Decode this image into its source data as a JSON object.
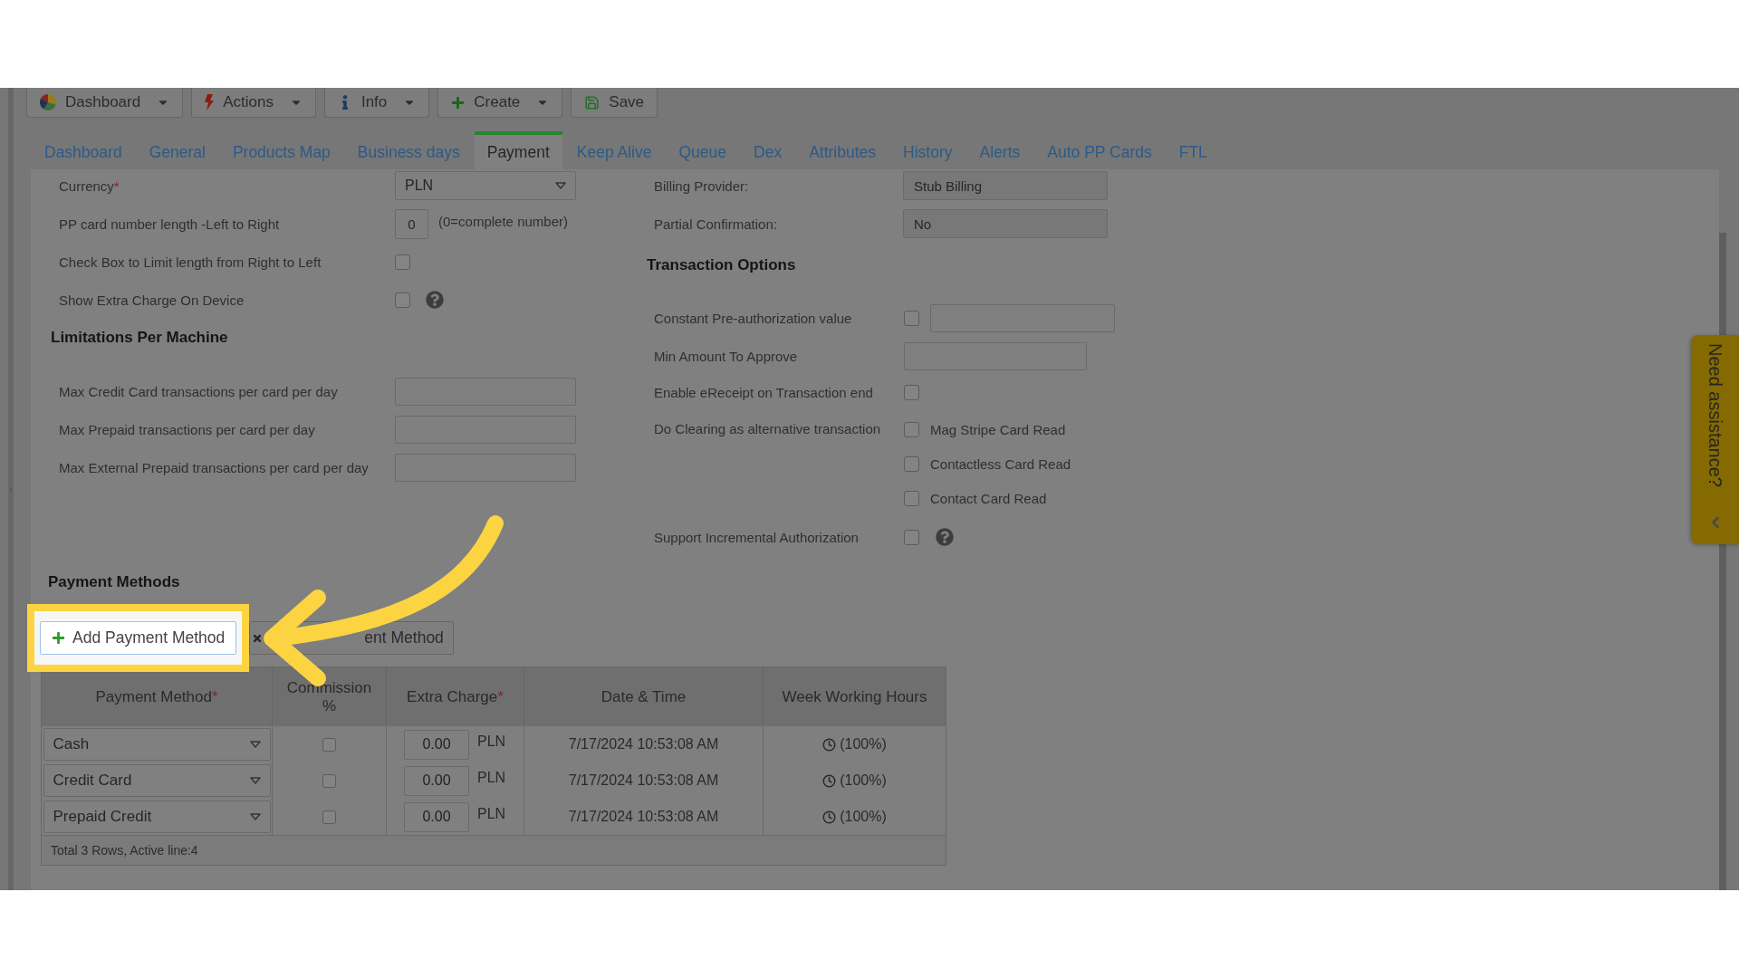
{
  "toolbar": [
    {
      "label": "Dashboard",
      "kind": "menu"
    },
    {
      "label": "Actions",
      "kind": "menu"
    },
    {
      "label": "Info",
      "kind": "menu"
    },
    {
      "label": "Create",
      "kind": "menu"
    },
    {
      "label": "Save",
      "kind": "button"
    }
  ],
  "tabs": [
    {
      "label": "Dashboard",
      "selected": false
    },
    {
      "label": "General",
      "selected": false
    },
    {
      "label": "Products Map",
      "selected": false
    },
    {
      "label": "Business days",
      "selected": false
    },
    {
      "label": "Payment",
      "selected": true
    },
    {
      "label": "Keep Alive",
      "selected": false
    },
    {
      "label": "Queue",
      "selected": false
    },
    {
      "label": "Dex",
      "selected": false
    },
    {
      "label": "Attributes",
      "selected": false
    },
    {
      "label": "History",
      "selected": false
    },
    {
      "label": "Alerts",
      "selected": false
    },
    {
      "label": "Auto PP Cards",
      "selected": false
    },
    {
      "label": "FTL",
      "selected": false
    }
  ],
  "general_settings": [
    {
      "kind": "select",
      "label": "Currency",
      "required_mark": "*",
      "value": "PLN"
    },
    {
      "kind": "number",
      "label": "PP card number length -Left to Right",
      "value": "0",
      "hint": "(0=complete number)"
    },
    {
      "kind": "checkbox",
      "label": "Check Box to Limit length from Right to Left",
      "checked": false
    },
    {
      "kind": "checkbox",
      "label": "Show Extra Charge On Device",
      "checked": false,
      "help": true
    }
  ],
  "limitations_per_machine": {
    "title": "Limitations Per Machine",
    "fields": [
      {
        "label": "Max Credit Card transactions per card per day"
      },
      {
        "label": "Max Prepaid transactions per card per day"
      },
      {
        "label": "Max External Prepaid transactions per card per day"
      }
    ]
  },
  "billing": [
    {
      "label": "Billing Provider:",
      "value": "Stub Billing"
    },
    {
      "label": "Partial Confirmation:",
      "value": "No"
    }
  ],
  "transaction_options": {
    "title": "Transaction Options",
    "rows": [
      {
        "kind": "checkbox_input",
        "label": "Constant Pre-authorization value",
        "checked": false
      },
      {
        "kind": "input",
        "label": "Min Amount To Approve"
      },
      {
        "kind": "checkbox",
        "label": "Enable eReceipt on Transaction end",
        "checked": false
      },
      {
        "kind": "checkbox_group",
        "label": "Do Clearing as alternative transaction",
        "options": [
          {
            "label": "Mag Stripe Card Read",
            "checked": false
          },
          {
            "label": "Contactless Card Read",
            "checked": false
          },
          {
            "label": "Contact Card Read",
            "checked": false
          }
        ]
      },
      {
        "kind": "checkbox",
        "label": "Support Incremental Authorization",
        "checked": false,
        "help": true
      }
    ]
  },
  "payment_methods": {
    "title": "Payment Methods",
    "buttons": [
      {
        "kind": "add",
        "label": "Add Payment Method",
        "highlighted": true
      },
      {
        "kind": "delete",
        "label": "ent Method",
        "highlighted": false
      }
    ],
    "table": {
      "columns": [
        {
          "label": "Payment Method",
          "required_mark": "*"
        },
        {
          "label": "Commission %"
        },
        {
          "label": "Extra Charge",
          "required_mark": "*"
        },
        {
          "label": "Date & Time"
        },
        {
          "label": "Week Working Hours"
        }
      ],
      "rows": [
        {
          "method": "Cash",
          "commission_checked": false,
          "extra_charge": "0.00",
          "currency": "PLN",
          "date_time": "7/17/2024 10:53:08 AM",
          "working_hours": "(100%)"
        },
        {
          "method": "Credit Card",
          "commission_checked": false,
          "extra_charge": "0.00",
          "currency": "PLN",
          "date_time": "7/17/2024 10:53:08 AM",
          "working_hours": "(100%)"
        },
        {
          "method": "Prepaid Credit",
          "commission_checked": false,
          "extra_charge": "0.00",
          "currency": "PLN",
          "date_time": "7/17/2024 10:53:08 AM",
          "working_hours": "(100%)"
        }
      ],
      "footer": "Total 3 Rows, Active line:4"
    }
  },
  "help_tab": {
    "label": "Need assistance?"
  }
}
